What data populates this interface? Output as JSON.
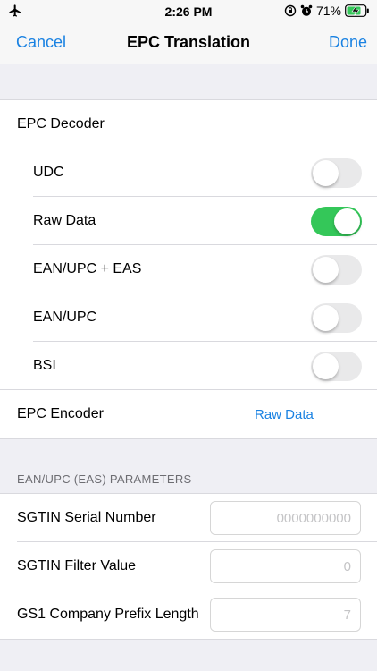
{
  "status_bar": {
    "time": "2:26 PM",
    "battery_percent": "71%",
    "icons": [
      "airplane-icon",
      "orientation-lock-icon",
      "alarm-icon",
      "battery-charging-icon"
    ]
  },
  "nav": {
    "cancel_label": "Cancel",
    "title": "EPC Translation",
    "done_label": "Done"
  },
  "decoder": {
    "header_label": "EPC Decoder",
    "options": [
      {
        "label": "UDC",
        "on": false
      },
      {
        "label": "Raw Data",
        "on": true
      },
      {
        "label": "EAN/UPC + EAS",
        "on": false
      },
      {
        "label": "EAN/UPC",
        "on": false
      },
      {
        "label": "BSI",
        "on": false
      }
    ]
  },
  "encoder": {
    "label": "EPC Encoder",
    "value": "Raw Data"
  },
  "params": {
    "section_title": "EAN/UPC (EAS) PARAMETERS",
    "fields": [
      {
        "label": "SGTIN Serial Number",
        "value": "",
        "placeholder": "0000000000"
      },
      {
        "label": "SGTIN Filter Value",
        "value": "",
        "placeholder": "0"
      },
      {
        "label": "GS1 Company Prefix Length",
        "value": "",
        "placeholder": "7"
      }
    ]
  },
  "colors": {
    "accent": "#1a82e2",
    "toggle_on": "#34c759",
    "toggle_off": "#e9e9ea",
    "background": "#efeff4"
  }
}
